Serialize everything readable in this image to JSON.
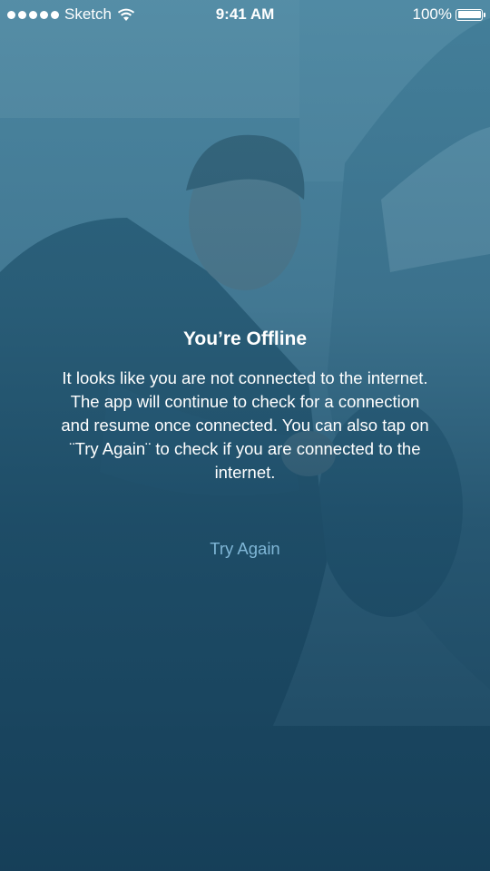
{
  "status_bar": {
    "carrier": "Sketch",
    "time": "9:41 AM",
    "battery": "100%",
    "signal_icon": "signal-dots-icon",
    "wifi_icon": "wifi-icon",
    "battery_icon": "battery-icon"
  },
  "offline": {
    "title": "You’re Offline",
    "message": "It looks like you are not connected to the internet.\nThe app will continue to check for a connection\nand resume once connected. You can also tap on\n¨Try Again¨ to check if you are connected to the\ninternet.",
    "try_again_label": "Try Again"
  },
  "colors": {
    "tint": "#2c6886",
    "link": "#7fb6d6",
    "text": "#ffffff"
  }
}
